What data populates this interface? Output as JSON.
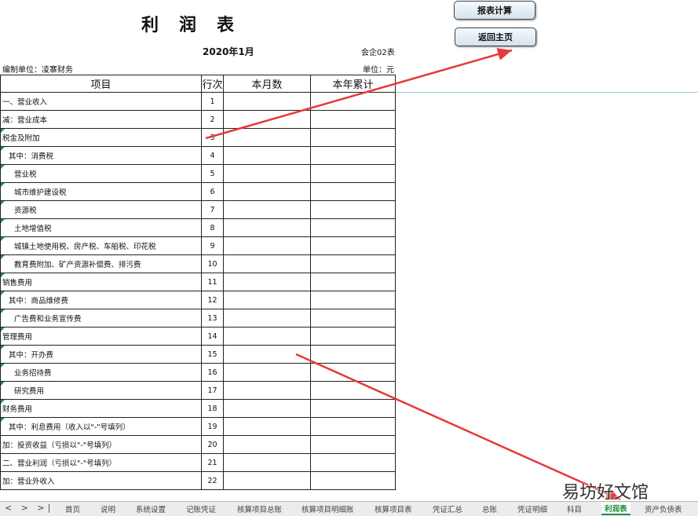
{
  "report": {
    "title": "利　润　表",
    "period": "2020年1月",
    "form_no": "会企02表",
    "org": "编制单位：凌寨财务",
    "unit": "单位：元"
  },
  "buttons": {
    "calculate": "报表计算",
    "home": "返回主页"
  },
  "table": {
    "headers": [
      "项目",
      "行次",
      "本月数",
      "本年累计"
    ],
    "rows": [
      {
        "item": "一、营业收入",
        "no": "1",
        "indent": 0,
        "mark": false
      },
      {
        "item": "减：营业成本",
        "no": "2",
        "indent": 0,
        "mark": false
      },
      {
        "item": "税金及附加",
        "no": "3",
        "indent": 0,
        "mark": true
      },
      {
        "item": "其中：消费税",
        "no": "4",
        "indent": 1,
        "mark": true
      },
      {
        "item": "营业税",
        "no": "5",
        "indent": 2,
        "mark": true
      },
      {
        "item": "城市维护建设税",
        "no": "6",
        "indent": 2,
        "mark": true
      },
      {
        "item": "资源税",
        "no": "7",
        "indent": 2,
        "mark": true
      },
      {
        "item": "土地增值税",
        "no": "8",
        "indent": 2,
        "mark": true
      },
      {
        "item": "城镇土地使用税、房产税、车船税、印花税",
        "no": "9",
        "indent": 2,
        "mark": true
      },
      {
        "item": "教育费附加、矿产资源补偿费、排污费",
        "no": "10",
        "indent": 2,
        "mark": true
      },
      {
        "item": "销售费用",
        "no": "11",
        "indent": 0,
        "mark": true
      },
      {
        "item": "其中：商品维修费",
        "no": "12",
        "indent": 1,
        "mark": true
      },
      {
        "item": "广告费和业务宣传费",
        "no": "13",
        "indent": 2,
        "mark": true
      },
      {
        "item": "管理费用",
        "no": "14",
        "indent": 0,
        "mark": true
      },
      {
        "item": "其中：开办费",
        "no": "15",
        "indent": 1,
        "mark": true
      },
      {
        "item": "业务招待费",
        "no": "16",
        "indent": 2,
        "mark": true
      },
      {
        "item": "研究费用",
        "no": "17",
        "indent": 2,
        "mark": true
      },
      {
        "item": "财务费用",
        "no": "18",
        "indent": 0,
        "mark": true
      },
      {
        "item": "其中：利息费用（收入以\"-\"号填列）",
        "no": "19",
        "indent": 1,
        "mark": true
      },
      {
        "item": "加：投资收益（亏损以\"-\"号填列）",
        "no": "20",
        "indent": 0,
        "mark": false
      },
      {
        "item": "二、营业利润（亏损以\"-\"号填列）",
        "no": "21",
        "indent": 0,
        "mark": false
      },
      {
        "item": "加：营业外收入",
        "no": "22",
        "indent": 0,
        "mark": false
      }
    ]
  },
  "sheet_tabs": [
    "首页",
    "说明",
    "系统设置",
    "记账凭证",
    "核算项目总账",
    "核算项目明细账",
    "核算项目表",
    "凭证汇总",
    "总账",
    "凭证明细",
    "科目",
    "利润表",
    "资产负债表"
  ],
  "active_tab": "利润表",
  "watermark": "易坊好文馆",
  "arrow_color": "#e8383b"
}
